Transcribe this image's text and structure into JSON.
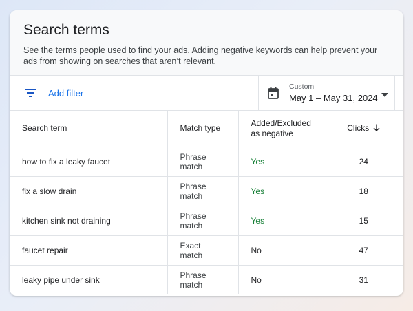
{
  "header": {
    "title": "Search terms",
    "description": "See the terms people used to find your ads. Adding negative keywords can help prevent your ads from showing on searches that aren’t relevant."
  },
  "toolbar": {
    "filter_label": "Add filter",
    "filter_icon": "filter-icon",
    "date_label": "Custom",
    "date_range": "May 1 – May 31, 2024",
    "calendar_icon": "calendar-icon",
    "dropdown_icon": "caret-down-icon"
  },
  "table": {
    "columns": {
      "search_term": "Search term",
      "match_type": "Match type",
      "added_excluded_line1": "Added/Excluded",
      "added_excluded_line2": "as negative",
      "clicks": "Clicks"
    },
    "sort": {
      "column": "clicks",
      "direction": "descending"
    },
    "rows": [
      {
        "term": "how to fix a leaky faucet",
        "match": "Phrase match",
        "negative": "Yes",
        "clicks": "24"
      },
      {
        "term": "fix a slow drain",
        "match": "Phrase match",
        "negative": "Yes",
        "clicks": "18"
      },
      {
        "term": "kitchen sink not draining",
        "match": "Phrase match",
        "negative": "Yes",
        "clicks": "15"
      },
      {
        "term": "faucet repair",
        "match": "Exact match",
        "negative": "No",
        "clicks": "47"
      },
      {
        "term": "leaky pipe under sink",
        "match": "Phrase match",
        "negative": "No",
        "clicks": "31"
      }
    ]
  },
  "colors": {
    "accent": "#1a73e8",
    "positive": "#188038",
    "icon": "#5f6368"
  }
}
